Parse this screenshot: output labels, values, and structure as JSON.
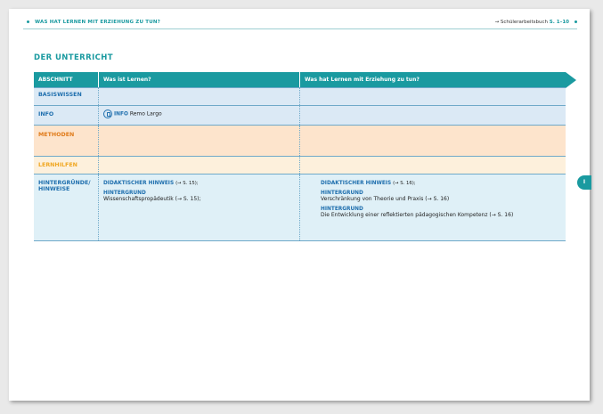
{
  "running_head": {
    "title": "WAS HAT LERNEN MIT ERZIEHUNG ZU TUN?",
    "ref_arrow": "→",
    "ref_text": "Schülerarbeitsbuch",
    "ref_pages": "S. 1–10"
  },
  "section_title": "DER UNTERRICHT",
  "table": {
    "headers": [
      "ABSCHNITT",
      "Was ist Lernen?",
      "Was hat Lernen mit Erziehung zu tun?"
    ],
    "rows": {
      "basiswissen": {
        "label": "BASISWISSEN"
      },
      "info": {
        "label": "INFO",
        "col2_prefix": "INFO",
        "col2_text": "Remo Largo"
      },
      "methoden": {
        "label": "METHODEN"
      },
      "lernhilfen": {
        "label": "LERNHILFEN"
      },
      "hintergruende": {
        "label": "HINTERGRÜNDE/ HINWEISE",
        "col2": [
          {
            "title": "DIDAKTISCHER HINWEIS",
            "ref": "(→ S. 15);",
            "text": ""
          },
          {
            "title": "HINTERGRUND",
            "ref": "",
            "text": "Wissenschaftspropädeutik (→ S. 15);"
          }
        ],
        "col3": [
          {
            "title": "DIDAKTISCHER HINWEIS",
            "ref": "(→ S. 16);",
            "text": ""
          },
          {
            "title": "HINTERGRUND",
            "ref": "",
            "text": "Verschränkung von Theorie und Praxis (→ S. 16)"
          },
          {
            "title": "HINTERGRUND",
            "ref": "",
            "text": "Die Entwicklung einer reflektierten pädagogischen Kompetenz (→ S. 16)"
          }
        ]
      }
    }
  },
  "side_tab": "I",
  "colors": {
    "teal": "#1a9aa0",
    "blue_label": "#1f6fae",
    "orange_label": "#e07b1a",
    "yellow_label": "#f0a722"
  }
}
